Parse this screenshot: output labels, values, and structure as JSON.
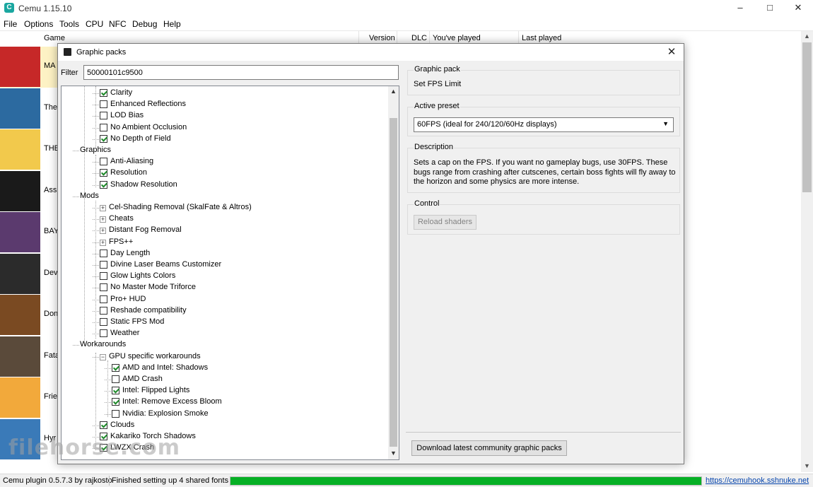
{
  "window": {
    "title": "Cemu 1.15.10",
    "minimize_icon": "minimize-icon",
    "maximize_icon": "maximize-icon",
    "close_icon": "close-icon"
  },
  "menu": [
    "File",
    "Options",
    "Tools",
    "CPU",
    "NFC",
    "Debug",
    "Help"
  ],
  "game_list": {
    "columns": [
      "Game",
      "Version",
      "DLC",
      "You've played",
      "Last played"
    ],
    "rows": [
      {
        "name": "MA",
        "icon": "mario-icon",
        "color": "#c62828"
      },
      {
        "name": "The",
        "icon": "zelda-icon",
        "color": "#2c6aa0"
      },
      {
        "name": "THE",
        "icon": "kirby-icon",
        "color": "#f2c94c"
      },
      {
        "name": "Ass",
        "icon": "assassin-icon",
        "color": "#1a1a1a"
      },
      {
        "name": "BAY",
        "icon": "bayonetta-icon",
        "color": "#5b3a6e"
      },
      {
        "name": "Dev",
        "icon": "devils-third-icon",
        "color": "#2b2b2b"
      },
      {
        "name": "Don",
        "icon": "donkey-kong-icon",
        "color": "#7a4a22"
      },
      {
        "name": "Fata",
        "icon": "fatal-frame-icon",
        "color": "#5a4a3a"
      },
      {
        "name": "Frie",
        "icon": "friends-icon",
        "color": "#f2a93b"
      },
      {
        "name": "Hyr",
        "icon": "hyrule-icon",
        "color": "#3a7ab8"
      }
    ]
  },
  "dialog": {
    "title": "Graphic packs",
    "filter_label": "Filter",
    "filter_value": "50000101c9500",
    "tree": [
      {
        "label": "Clarity",
        "checked": true
      },
      {
        "label": "Enhanced Reflections",
        "checked": false
      },
      {
        "label": "LOD Bias",
        "checked": false
      },
      {
        "label": "No Ambient Occlusion",
        "checked": false
      },
      {
        "label": "No Depth of Field",
        "checked": true
      },
      {
        "label": "Graphics"
      },
      {
        "label": "Anti-Aliasing",
        "checked": false
      },
      {
        "label": "Resolution",
        "checked": true
      },
      {
        "label": "Shadow Resolution",
        "checked": true
      },
      {
        "label": "Mods"
      },
      {
        "label": "Cel-Shading Removal (SkalFate & Altros)"
      },
      {
        "label": "Cheats"
      },
      {
        "label": "Distant Fog Removal"
      },
      {
        "label": "FPS++"
      },
      {
        "label": "Day Length",
        "checked": false
      },
      {
        "label": "Divine Laser Beams Customizer",
        "checked": false
      },
      {
        "label": "Glow Lights Colors",
        "checked": false
      },
      {
        "label": "No Master Mode Triforce",
        "checked": false
      },
      {
        "label": "Pro+ HUD",
        "checked": false
      },
      {
        "label": "Reshade compatibility",
        "checked": false
      },
      {
        "label": "Static FPS Mod",
        "checked": false
      },
      {
        "label": "Weather",
        "checked": false
      },
      {
        "label": "Workarounds"
      },
      {
        "label": "GPU specific workarounds"
      },
      {
        "label": "AMD and Intel: Shadows",
        "checked": true
      },
      {
        "label": "AMD Crash",
        "checked": false
      },
      {
        "label": "Intel: Flipped Lights",
        "checked": true
      },
      {
        "label": "Intel: Remove Excess Bloom",
        "checked": true
      },
      {
        "label": "Nvidia: Explosion Smoke",
        "checked": false
      },
      {
        "label": "Clouds",
        "checked": true
      },
      {
        "label": "Kakariko Torch Shadows",
        "checked": true
      },
      {
        "label": "LWZX Crash",
        "checked": true
      }
    ],
    "graphic_pack": {
      "label": "Graphic pack",
      "value": "Set FPS Limit"
    },
    "active_preset": {
      "label": "Active preset",
      "value": "60FPS (ideal for 240/120/60Hz displays)"
    },
    "description": {
      "label": "Description",
      "text": "Sets a cap on the FPS. If you want no gameplay bugs, use 30FPS. These bugs range from crashing after cutscenes, certain boss fights will fly away to the horizon and some physics are more intense."
    },
    "control": {
      "label": "Control",
      "reload_button": "Reload shaders"
    },
    "download_button": "Download latest community graphic packs"
  },
  "status_bar": {
    "plugin": "Cemu plugin 0.5.7.3 by rajkosto",
    "message": "Finished setting up 4 shared fonts",
    "progress": 1.0,
    "link": "https://cemuhook.sshnuke.net"
  },
  "watermark": "filehorse.com"
}
